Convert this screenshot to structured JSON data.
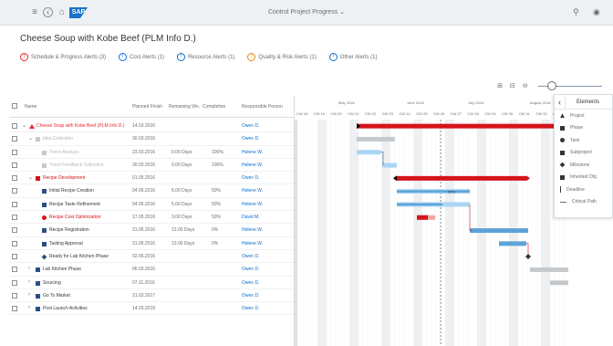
{
  "shell": {
    "title": "Control Project Progress",
    "logo": "SAP",
    "back_icon": "back-icon",
    "home_icon": "home-icon"
  },
  "object": {
    "title": "Cheese Soup with Kobe Beef (PLM Info D.)"
  },
  "actions": [
    {
      "label": "Schedule & Progress Alerts (3)",
      "icon": "alert-icon",
      "color": "#e9262a"
    },
    {
      "label": "Cost Alerts (1)",
      "icon": "cost-icon",
      "color": "#0a6ed1"
    },
    {
      "label": "Resource Alerts (1)",
      "icon": "resource-icon",
      "color": "#0a6ed1"
    },
    {
      "label": "Quality & Risk Alerts (1)",
      "icon": "quality-icon",
      "color": "#e78c07"
    },
    {
      "label": "Other Alerts (1)",
      "icon": "document-icon",
      "color": "#0a6ed1"
    }
  ],
  "table": {
    "columns": [
      "Name",
      "Planned Finish",
      "Remaining Wo.",
      "Completion",
      "Responsible Person"
    ],
    "rows": [
      {
        "indent": 0,
        "toggle": "v",
        "name": "Cheese Soup with Kobe Beef (PLM Info D.)",
        "finish": "14.03.2016",
        "remaining": "",
        "completion": "",
        "person": "Owen D.",
        "color": "#e9262a",
        "shape": "triangle",
        "text_color": "#e9262a"
      },
      {
        "indent": 1,
        "toggle": "v",
        "name": "Idea Collection",
        "finish": "30.03.2016",
        "remaining": "",
        "completion": "",
        "person": "Owen D.",
        "color": "#c6c9cc",
        "shape": "square",
        "text_color": "#b5b9bc"
      },
      {
        "indent": 2,
        "toggle": "",
        "name": "Trend Analysis",
        "finish": "23.03.2016",
        "remaining": "0.00 Days",
        "completion": "100%",
        "person": "Helene W.",
        "color": "#c6c9cc",
        "shape": "square",
        "text_color": "#b5b9bc"
      },
      {
        "indent": 2,
        "toggle": "",
        "name": "Trend Feedback Collection",
        "finish": "30.03.2016",
        "remaining": "0.00 Days",
        "completion": "100%",
        "person": "Helene W.",
        "color": "#c6c9cc",
        "shape": "square",
        "text_color": "#b5b9bc"
      },
      {
        "indent": 1,
        "toggle": "v",
        "name": "Recipe Development",
        "finish": "01.05.2016",
        "remaining": "",
        "completion": "",
        "person": "Owen D.",
        "color": "#d4141a",
        "shape": "square",
        "text_color": "#d4141a"
      },
      {
        "indent": 2,
        "toggle": "",
        "name": "Initial Recipe Creation",
        "finish": "04.05.2016",
        "remaining": "5.00 Days",
        "completion": "50%",
        "person": "Helene W.",
        "color": "#2b4f83",
        "shape": "square",
        "text_color": "#32363a"
      },
      {
        "indent": 2,
        "toggle": "",
        "name": "Recipe Taste Refinement",
        "finish": "04.05.2016",
        "remaining": "5.00 Days",
        "completion": "50%",
        "person": "Helene W.",
        "color": "#2b4f83",
        "shape": "square",
        "text_color": "#32363a"
      },
      {
        "indent": 2,
        "toggle": "",
        "name": "Recipe Cost Optimization",
        "finish": "17.05.2016",
        "remaining": "3.00 Days",
        "completion": "50%",
        "person": "David M.",
        "color": "#d4141a",
        "shape": "circle",
        "text_color": "#d4141a"
      },
      {
        "indent": 2,
        "toggle": "",
        "name": "Recipe Registration",
        "finish": "31.05.2016",
        "remaining": "13.00 Days",
        "completion": "0%",
        "person": "Helene W.",
        "color": "#2b4f83",
        "shape": "square",
        "text_color": "#32363a"
      },
      {
        "indent": 2,
        "toggle": "",
        "name": "Tasting Approval",
        "finish": "31.05.2016",
        "remaining": "13.00 Days",
        "completion": "0%",
        "person": "Helene W.",
        "color": "#2b4f83",
        "shape": "square",
        "text_color": "#32363a"
      },
      {
        "indent": 2,
        "toggle": "",
        "name": "Ready for Lab Kitchen Phase",
        "finish": "02.06.2016",
        "remaining": "",
        "completion": "",
        "person": "Owen D.",
        "color": "#2b4f83",
        "shape": "diamond",
        "text_color": "#32363a"
      },
      {
        "indent": 1,
        "toggle": ">",
        "name": "Lab Kitchen Phase",
        "finish": "06.03.2016",
        "remaining": "",
        "completion": "",
        "person": "Owen D.",
        "color": "#2b4f83",
        "shape": "square",
        "text_color": "#32363a"
      },
      {
        "indent": 1,
        "toggle": ">",
        "name": "Sourcing",
        "finish": "07.11.2016",
        "remaining": "",
        "completion": "",
        "person": "Owen D.",
        "color": "#2b4f83",
        "shape": "square",
        "text_color": "#32363a"
      },
      {
        "indent": 1,
        "toggle": ">",
        "name": "Go To Market",
        "finish": "21.03.2017",
        "remaining": "",
        "completion": "",
        "person": "Owen D.",
        "color": "#2b4f83",
        "shape": "square",
        "text_color": "#32363a"
      },
      {
        "indent": 1,
        "toggle": ">",
        "name": "Post Launch Activities",
        "finish": "14.03.2018",
        "remaining": "",
        "completion": "",
        "person": "Owen D.",
        "color": "#2b4f83",
        "shape": "square",
        "text_color": "#32363a"
      }
    ]
  },
  "timeline": {
    "months": [
      "May 2016",
      "June 2016",
      "July 2016",
      "August 2016"
    ],
    "weeks": [
      "CW 18",
      "CW 19",
      "CW 20",
      "CW 21",
      "CW 22",
      "CW 23",
      "CW 24",
      "CW 25",
      "CW 26",
      "CW 27",
      "CW 28",
      "CW 29",
      "CW 30",
      "CW 31",
      "CW 32",
      "CW 33"
    ],
    "progress_label": "50%"
  },
  "legend": {
    "title": "Elements",
    "items": [
      {
        "label": "Project",
        "color": "#32363a",
        "shape": "triangle"
      },
      {
        "label": "Phase",
        "color": "#32363a",
        "shape": "square"
      },
      {
        "label": "Task",
        "color": "#32363a",
        "shape": "circle"
      },
      {
        "label": "Subproject",
        "color": "#32363a",
        "shape": "square"
      },
      {
        "label": "Milestone",
        "color": "#32363a",
        "shape": "diamond"
      },
      {
        "label": "Inherited Obj.",
        "color": "#32363a",
        "shape": "square"
      },
      {
        "label": "Deadline",
        "color": "#32363a",
        "shape": "line"
      },
      {
        "label": "Critical Path",
        "color": "#6a6d70",
        "shape": "hline"
      }
    ]
  },
  "toolbar": {
    "icons": [
      "expand-icon",
      "collapse-icon",
      "zoom-out-icon",
      "zoom-in-icon"
    ]
  }
}
